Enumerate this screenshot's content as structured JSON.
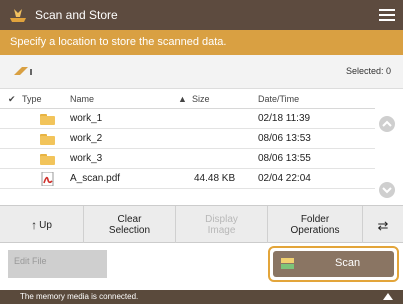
{
  "window": {
    "title": "Scan and Store"
  },
  "instruction": "Specify a location to store the scanned data.",
  "info": {
    "selected": "Selected: 0"
  },
  "table": {
    "headers": {
      "type": "Type",
      "name": "Name",
      "size": "Size",
      "datetime": "Date/Time"
    },
    "rows": [
      {
        "kind": "folder",
        "name": "work_1",
        "size": "",
        "datetime": "02/18 11:39"
      },
      {
        "kind": "folder",
        "name": "work_2",
        "size": "",
        "datetime": "08/06 13:53"
      },
      {
        "kind": "folder",
        "name": "work_3",
        "size": "",
        "datetime": "08/06 13:55"
      },
      {
        "kind": "pdf",
        "name": "A_scan.pdf",
        "size": "44.48 KB",
        "datetime": "02/04 22:04"
      }
    ]
  },
  "toolbar": {
    "up": "Up",
    "clear_selection": "Clear Selection",
    "display_image": "Display Image",
    "folder_operations": "Folder Operations"
  },
  "bottom": {
    "edit_file": "Edit File",
    "scan": "Scan"
  },
  "status": "The memory media is connected.",
  "colors": {
    "titlebar": "#5d4b3f",
    "accent": "#d9a042",
    "scan_button": "#8a7563"
  }
}
